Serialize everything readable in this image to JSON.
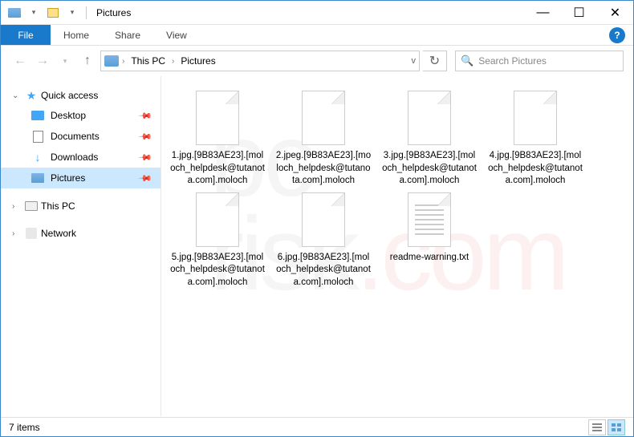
{
  "titlebar": {
    "title": "Pictures",
    "win": {
      "min": "—",
      "max": "☐",
      "close": "✕"
    }
  },
  "ribbon": {
    "file": "File",
    "tabs": [
      "Home",
      "Share",
      "View"
    ]
  },
  "breadcrumb": {
    "parts": [
      "This PC",
      "Pictures"
    ],
    "dropdown": "v"
  },
  "search": {
    "placeholder": "Search Pictures"
  },
  "sidebar": {
    "quick_access": "Quick access",
    "items": [
      {
        "label": "Desktop",
        "icon": "desk"
      },
      {
        "label": "Documents",
        "icon": "doc"
      },
      {
        "label": "Downloads",
        "icon": "down"
      },
      {
        "label": "Pictures",
        "icon": "pic",
        "selected": true
      }
    ],
    "this_pc": "This PC",
    "network": "Network"
  },
  "files": [
    {
      "name": "1.jpg.[9B83AE23].[moloch_helpdesk@tutanota.com].moloch",
      "type": "blank"
    },
    {
      "name": "2.jpeg.[9B83AE23].[moloch_helpdesk@tutanota.com].moloch",
      "type": "blank"
    },
    {
      "name": "3.jpg.[9B83AE23].[moloch_helpdesk@tutanota.com].moloch",
      "type": "blank"
    },
    {
      "name": "4.jpg.[9B83AE23].[moloch_helpdesk@tutanota.com].moloch",
      "type": "blank"
    },
    {
      "name": "5.jpg.[9B83AE23].[moloch_helpdesk@tutanota.com].moloch",
      "type": "blank"
    },
    {
      "name": "6.jpg.[9B83AE23].[moloch_helpdesk@tutanota.com].moloch",
      "type": "blank"
    },
    {
      "name": "readme-warning.txt",
      "type": "txt"
    }
  ],
  "status": {
    "count": "7 items"
  },
  "watermark": "pc\nrisk.com"
}
